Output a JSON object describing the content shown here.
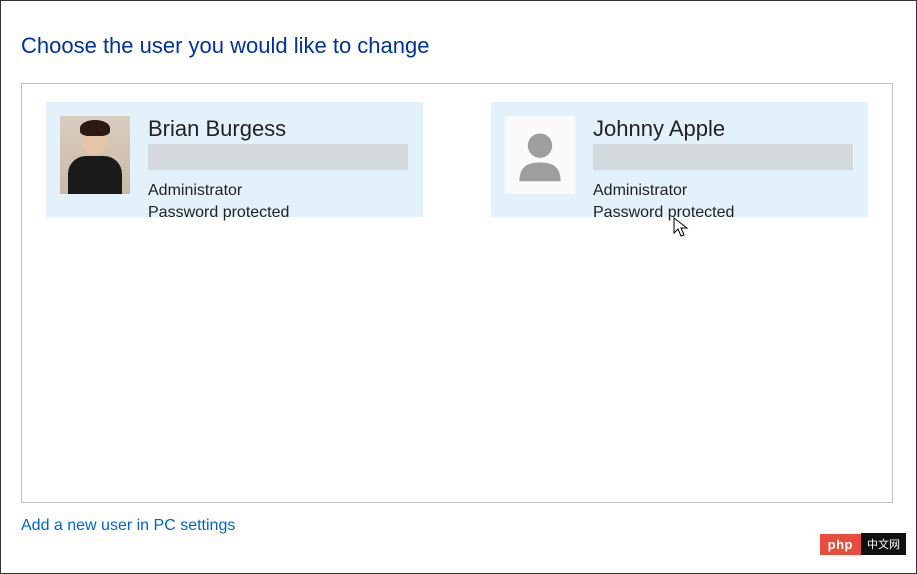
{
  "title": "Choose the user you would like to change",
  "users": [
    {
      "name": "Brian Burgess",
      "role": "Administrator",
      "status": "Password protected",
      "avatar_type": "photo"
    },
    {
      "name": "Johnny Apple",
      "role": "Administrator",
      "status": "Password protected",
      "avatar_type": "default"
    }
  ],
  "link_add_user": "Add a new user in PC settings",
  "watermark": {
    "left": "php",
    "right": "中文网"
  }
}
